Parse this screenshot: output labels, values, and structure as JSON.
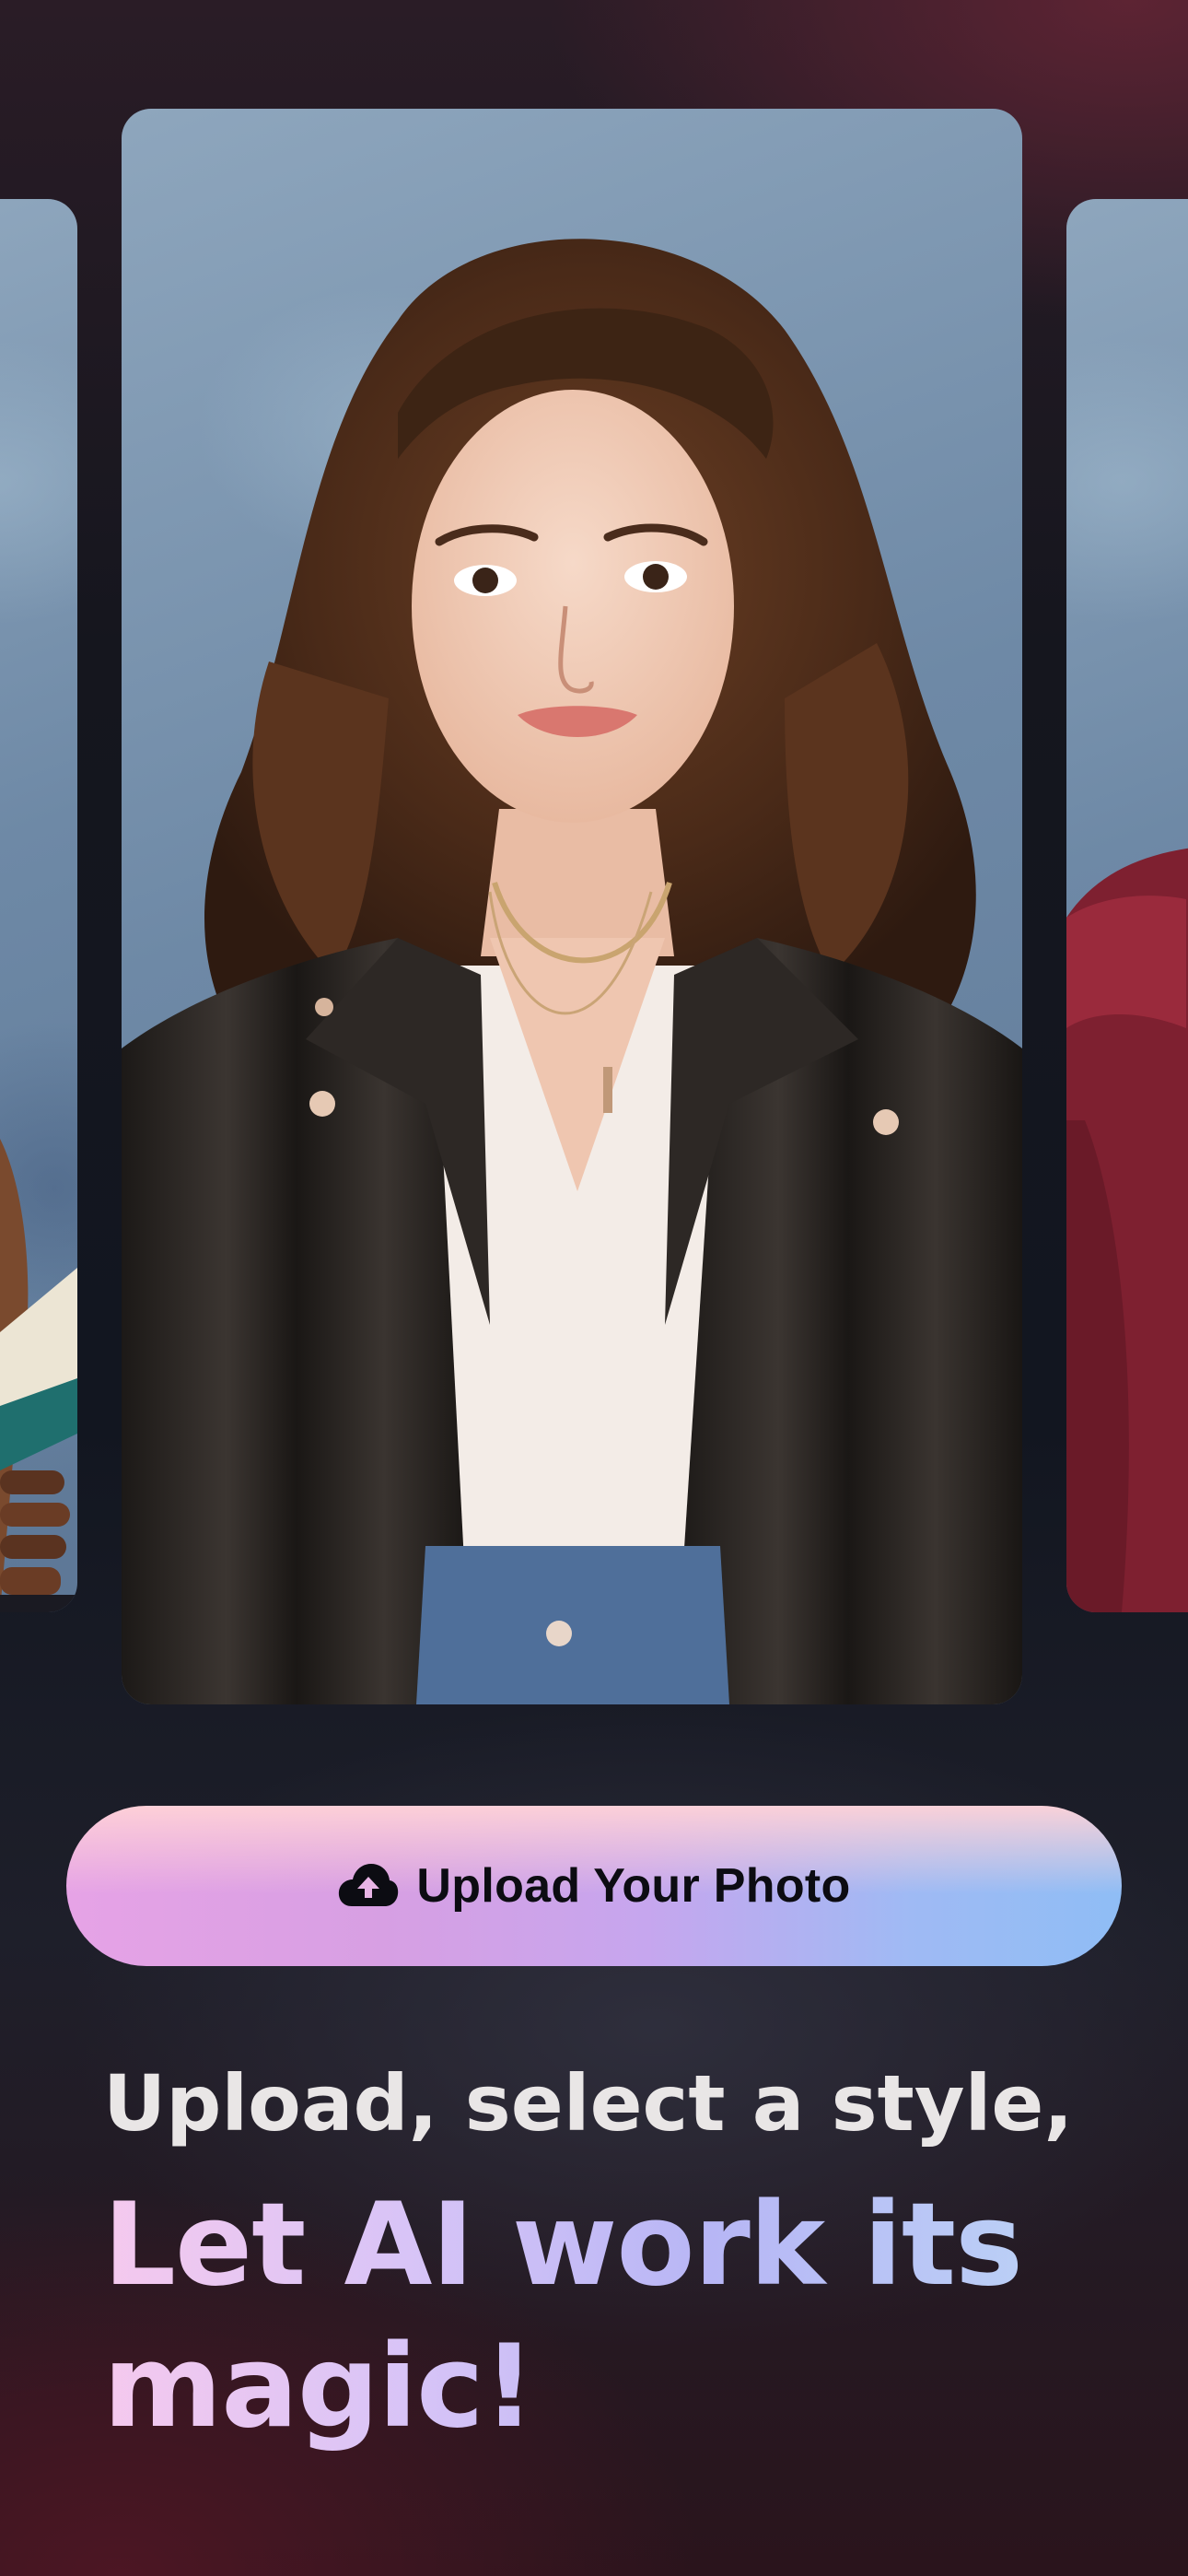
{
  "carousel": {
    "cards": [
      {
        "id": "left",
        "subject": "person holding a book"
      },
      {
        "id": "center",
        "subject": "young woman with curly hair in leather jacket"
      },
      {
        "id": "right",
        "subject": "person in red hoodie"
      }
    ]
  },
  "upload_button": {
    "icon": "cloud-upload-icon",
    "label": "Upload Your Photo"
  },
  "headline": {
    "subtitle": "Upload, select a style,",
    "title": "Let AI work its magic!"
  },
  "colors": {
    "background_top": "#2a1c26",
    "background_mid": "#121620",
    "button_gradient_start": "#e6a3e6",
    "button_gradient_end": "#8fbdf5",
    "button_top_glow": "#ffd2d7",
    "title_gradient_start": "#f5c9ee",
    "title_gradient_end": "#bcd6f7",
    "subtitle_text": "#e9e6e6"
  }
}
